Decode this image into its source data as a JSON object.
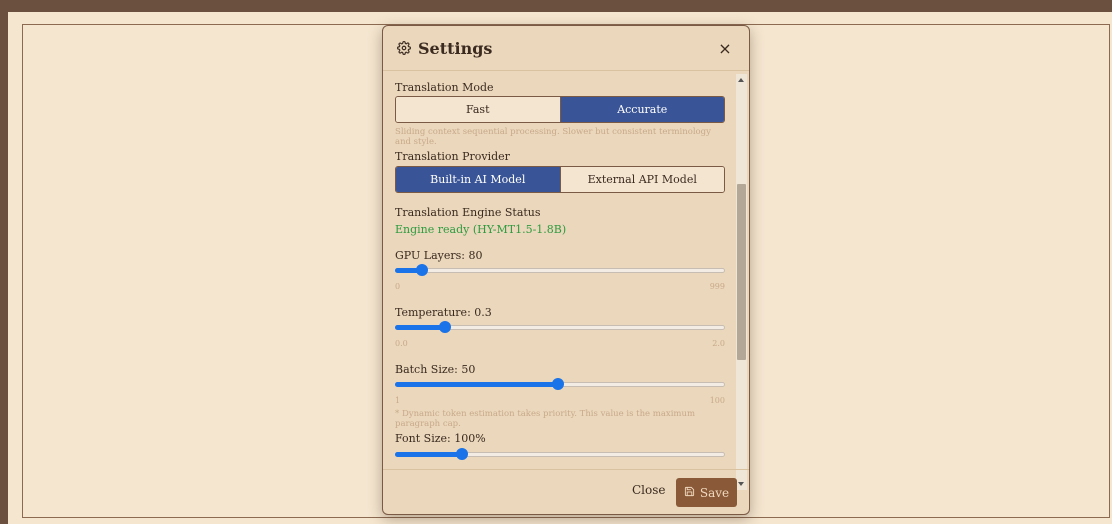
{
  "modal": {
    "title": "Settings",
    "title_icon": "gear-icon",
    "close_glyph": "×"
  },
  "translation_mode": {
    "label": "Translation Mode",
    "options": [
      "Fast",
      "Accurate"
    ],
    "selected": "Accurate",
    "hint": "Sliding context sequential processing. Slower but consistent terminology and style."
  },
  "translation_provider": {
    "label": "Translation Provider",
    "options": [
      "Built-in AI Model",
      "External API Model"
    ],
    "selected": "Built-in AI Model"
  },
  "engine_status": {
    "label": "Translation Engine Status",
    "value": "Engine ready (HY-MT1.5-1.8B)",
    "color": "#2e9b3f"
  },
  "gpu_layers": {
    "label": "GPU Layers: 80",
    "value": 80,
    "min": 0,
    "max": 999,
    "min_label": "0",
    "max_label": "999"
  },
  "temperature": {
    "label": "Temperature: 0.3",
    "value": 0.3,
    "min": 0.0,
    "max": 2.0,
    "min_label": "0.0",
    "max_label": "2.0"
  },
  "batch_size": {
    "label": "Batch Size: 50",
    "value": 50,
    "min": 1,
    "max": 100,
    "min_label": "1",
    "max_label": "100",
    "hint": "* Dynamic token estimation takes priority. This value is the maximum paragraph cap."
  },
  "font_size": {
    "label": "Font Size: 100%",
    "value": 100,
    "min": 50,
    "max": 300
  },
  "footer": {
    "close_label": "Close",
    "save_label": "Save",
    "save_icon": "save-icon"
  },
  "colors": {
    "accent": "#3a5597",
    "slider": "#1a73e8",
    "save_button": "#8a5a38",
    "modal_bg": "#ead7bc"
  }
}
